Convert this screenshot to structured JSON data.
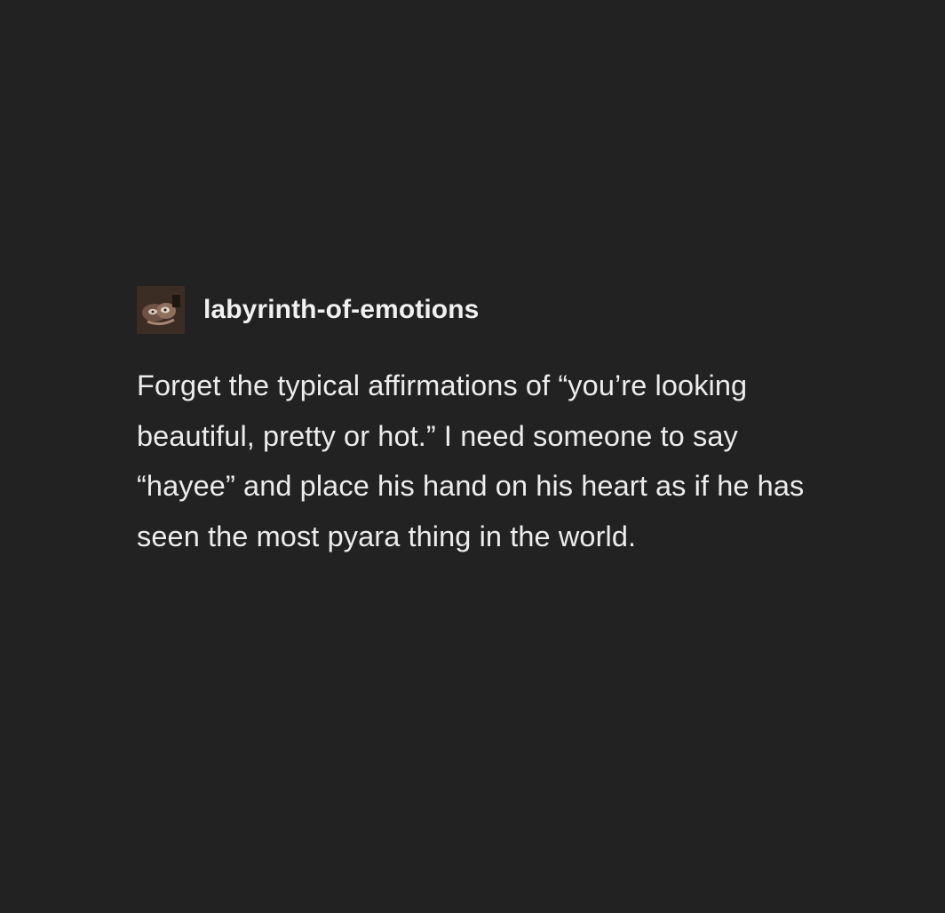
{
  "post": {
    "username": "labyrinth-of-emotions",
    "avatar_icon": "profile-photo",
    "body": "Forget the typical affirmations of “you’re looking beautiful, pretty or hot.” I need someone to say “hayee” and place his hand on his heart as if he has seen the most pyara thing in the world."
  },
  "colors": {
    "background": "#222222",
    "text": "#ececec"
  }
}
